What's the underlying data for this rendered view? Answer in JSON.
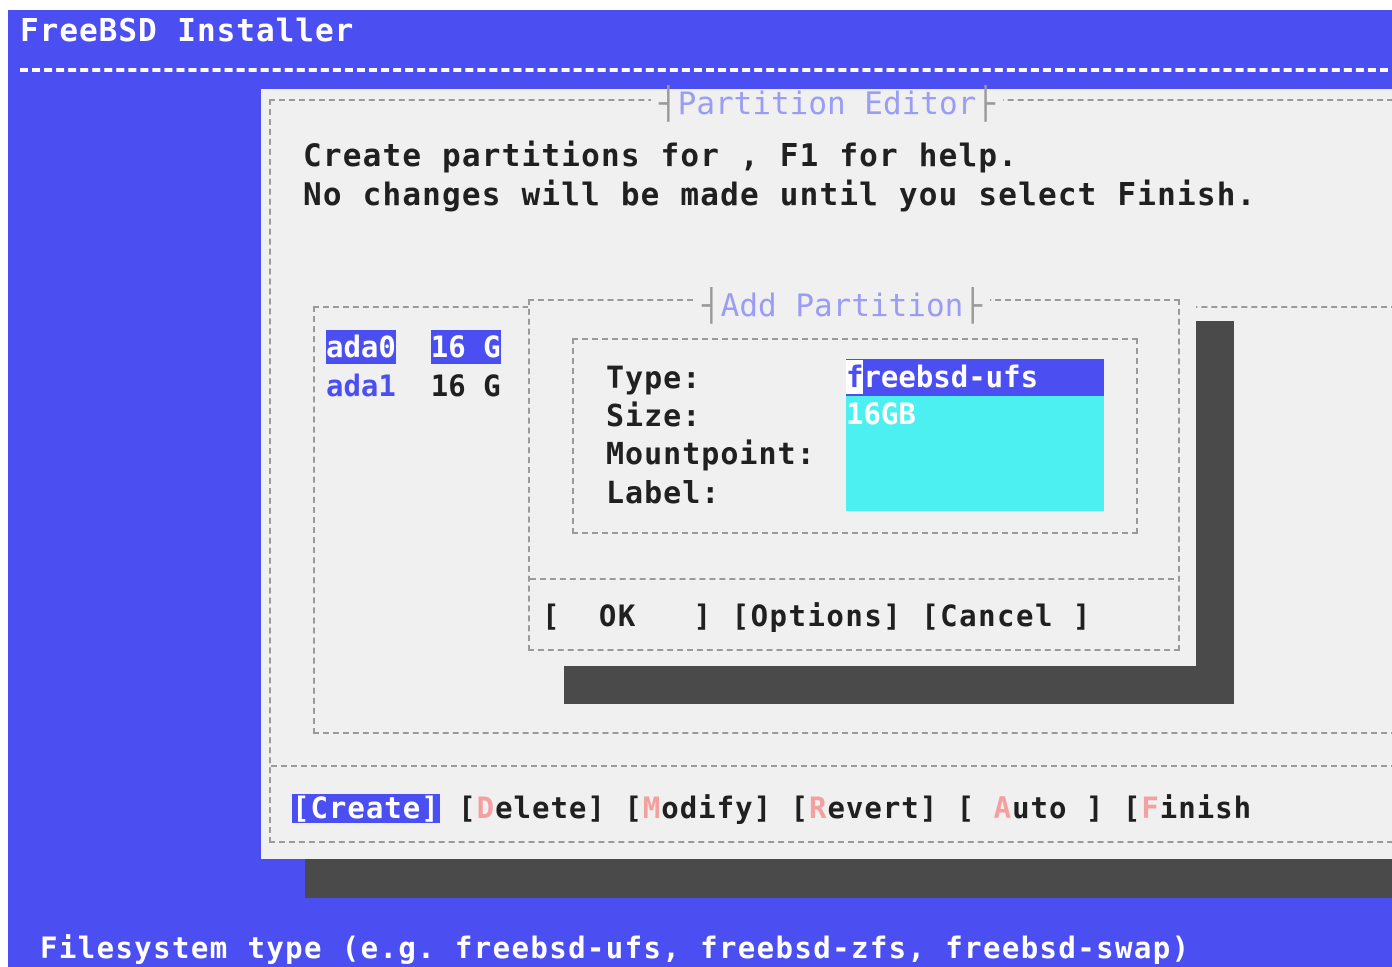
{
  "installer": {
    "title": "FreeBSD Installer",
    "status_text": "Filesystem type (e.g. freebsd-ufs, freebsd-zfs, freebsd-swap)"
  },
  "partition_editor": {
    "title": "Partition Editor",
    "message_line1": "Create partitions for , F1 for help.",
    "message_line2": "No changes will be made until you select Finish.",
    "disks": [
      {
        "name": "ada0",
        "size": "16 G",
        "selected": true
      },
      {
        "name": "ada1",
        "size": "16 G",
        "selected": false
      }
    ],
    "buttons": {
      "create": "[Create]",
      "delete_open": "[",
      "delete_hot": "D",
      "delete_rest": "elete]",
      "modify_open": "[",
      "modify_hot": "M",
      "modify_rest": "odify]",
      "revert_open": "[",
      "revert_hot": "R",
      "revert_rest": "evert]",
      "auto_open": "[ ",
      "auto_hot": "A",
      "auto_rest": "uto ]",
      "finish_open": "[",
      "finish_hot": "F",
      "finish_rest": "inish"
    }
  },
  "add_partition": {
    "title": "Add Partition",
    "labels": {
      "type": "Type:",
      "size": "Size:",
      "mountpoint": "Mountpoint:",
      "label": "Label:"
    },
    "values": {
      "type_first": "f",
      "type_rest": "reebsd-ufs",
      "size": "16GB",
      "mountpoint": "",
      "label": ""
    },
    "buttons": {
      "ok": "[  OK   ]",
      "options": "[Options]",
      "cancel": "[Cancel ]"
    }
  },
  "colors": {
    "background": "#4b4ef0",
    "dialog": "#f0f0f0",
    "field": "#4cf0f0",
    "shadow": "#4a4a4a",
    "hotkey": "#f4a0a0"
  }
}
